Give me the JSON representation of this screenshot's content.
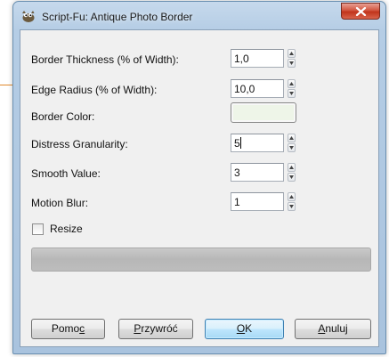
{
  "window": {
    "title": "Script-Fu: Antique Photo Border",
    "icon": "gimp-wilber-icon",
    "close_icon": "close-x-icon"
  },
  "fields": {
    "border_thickness": {
      "label": "Border Thickness (% of Width):",
      "value": "1,0"
    },
    "edge_radius": {
      "label": "Edge Radius (% of Width):",
      "value": "10,0"
    },
    "border_color": {
      "label": "Border Color:",
      "color": "#eef5e8"
    },
    "distress_granularity": {
      "label": "Distress Granularity:",
      "value": "5"
    },
    "smooth_value": {
      "label": "Smooth Value:",
      "value": "3"
    },
    "motion_blur": {
      "label": "Motion Blur:",
      "value": "1"
    }
  },
  "resize": {
    "label": "Resize",
    "checked": false
  },
  "progress": {
    "fraction": 0
  },
  "buttons": {
    "help": {
      "pre": "Pomo",
      "mnemonic": "c",
      "post": ""
    },
    "reset": {
      "pre": "",
      "mnemonic": "P",
      "post": "rzywróć"
    },
    "ok": {
      "pre": "",
      "mnemonic": "O",
      "post": "K"
    },
    "cancel": {
      "pre": "",
      "mnemonic": "A",
      "post": "nuluj"
    }
  },
  "colors": {
    "accent": "#3c7fb1",
    "close_button": "#c0341c",
    "side_line": "#e08a2e"
  }
}
